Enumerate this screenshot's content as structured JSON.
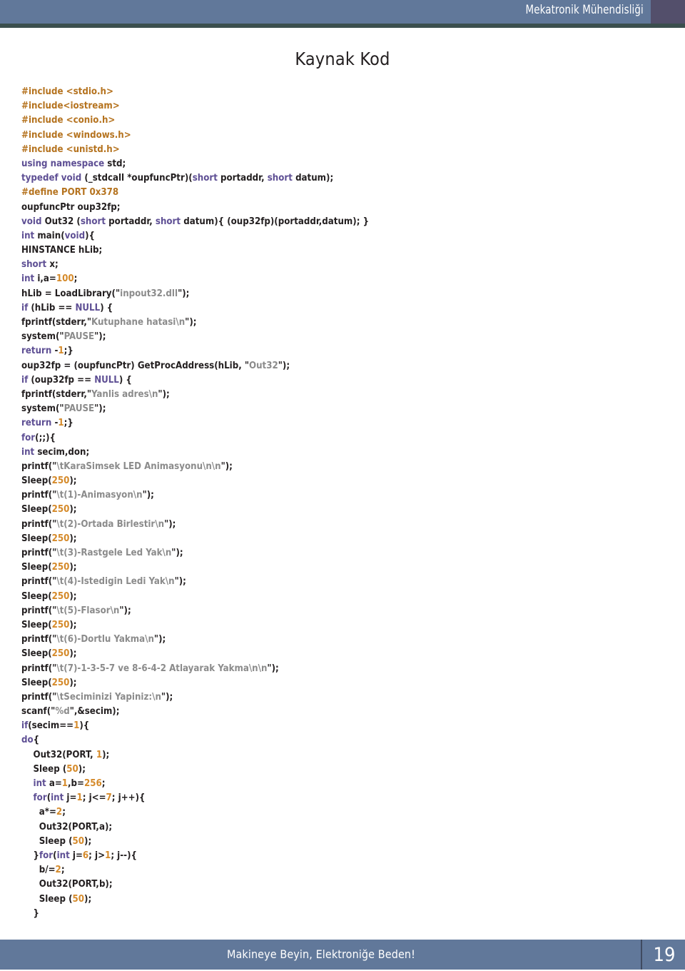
{
  "header": {
    "title": "Mekatronik Mühendisliği",
    "band_color": "#61789a",
    "right_block_color": "#534f6b",
    "rule_color": "#3b4f4e"
  },
  "page_title": "Kaynak Kod",
  "footer": {
    "tagline": "Makineye Beyin, Elektroniğe Beden!",
    "page_number": "19",
    "band_color": "#61789a"
  },
  "syntax_colors": {
    "keyword": "#5e4f94",
    "preprocessor": "#b5731f",
    "number": "#d58a2a",
    "string": "#8b8b8b",
    "default": "#231f20"
  },
  "code": {
    "language": "cpp",
    "lines": [
      [
        {
          "t": "#include <stdio.h>",
          "c": "pp"
        }
      ],
      [
        {
          "t": "#include<iostream>",
          "c": "pp"
        }
      ],
      [
        {
          "t": "#include <conio.h>",
          "c": "pp"
        }
      ],
      [
        {
          "t": "#include <windows.h>",
          "c": "pp"
        }
      ],
      [
        {
          "t": "#include <unistd.h>",
          "c": "pp"
        }
      ],
      [
        {
          "t": "using namespace ",
          "c": "k"
        },
        {
          "t": "std;",
          "c": "d"
        }
      ],
      [
        {
          "t": "typedef void ",
          "c": "k"
        },
        {
          "t": "(_stdcall *oupfuncPtr)(",
          "c": "d"
        },
        {
          "t": "short ",
          "c": "k"
        },
        {
          "t": "portaddr, ",
          "c": "d"
        },
        {
          "t": "short ",
          "c": "k"
        },
        {
          "t": "datum);",
          "c": "d"
        }
      ],
      [
        {
          "t": "#define PORT 0x378",
          "c": "pp"
        }
      ],
      [
        {
          "t": "oupfuncPtr oup32fp;",
          "c": "d"
        }
      ],
      [
        {
          "t": "void ",
          "c": "k"
        },
        {
          "t": "Out32 (",
          "c": "d"
        },
        {
          "t": "short ",
          "c": "k"
        },
        {
          "t": "portaddr, ",
          "c": "d"
        },
        {
          "t": "short ",
          "c": "k"
        },
        {
          "t": "datum){ (oup32fp)(portaddr,datum); }",
          "c": "d"
        }
      ],
      [
        {
          "t": "int ",
          "c": "k"
        },
        {
          "t": "main(",
          "c": "d"
        },
        {
          "t": "void",
          "c": "k"
        },
        {
          "t": "){",
          "c": "d"
        }
      ],
      [
        {
          "t": "HINSTANCE hLib;",
          "c": "d"
        }
      ],
      [
        {
          "t": "short ",
          "c": "k"
        },
        {
          "t": "x;",
          "c": "d"
        }
      ],
      [
        {
          "t": "int ",
          "c": "k"
        },
        {
          "t": "i,a=",
          "c": "d"
        },
        {
          "t": "100",
          "c": "n"
        },
        {
          "t": ";",
          "c": "d"
        }
      ],
      [
        {
          "t": "hLib = LoadLibrary(\"",
          "c": "d"
        },
        {
          "t": "inpout32.dll",
          "c": "s"
        },
        {
          "t": "\");",
          "c": "d"
        }
      ],
      [
        {
          "t": "if ",
          "c": "k"
        },
        {
          "t": "(hLib == ",
          "c": "d"
        },
        {
          "t": "NULL",
          "c": "k"
        },
        {
          "t": ") {",
          "c": "d"
        }
      ],
      [
        {
          "t": "fprintf(stderr,\"",
          "c": "d"
        },
        {
          "t": "Kutuphane hatasi\\n",
          "c": "s"
        },
        {
          "t": "\");",
          "c": "d"
        }
      ],
      [
        {
          "t": "system(\"",
          "c": "d"
        },
        {
          "t": "PAUSE",
          "c": "s"
        },
        {
          "t": "\");",
          "c": "d"
        }
      ],
      [
        {
          "t": "return ",
          "c": "k"
        },
        {
          "t": "-",
          "c": "d"
        },
        {
          "t": "1",
          "c": "n"
        },
        {
          "t": ";}",
          "c": "d"
        }
      ],
      [
        {
          "t": "oup32fp = (oupfuncPtr) GetProcAddress(hLib, \"",
          "c": "d"
        },
        {
          "t": "Out32",
          "c": "s"
        },
        {
          "t": "\");",
          "c": "d"
        }
      ],
      [
        {
          "t": "if ",
          "c": "k"
        },
        {
          "t": "(oup32fp == ",
          "c": "d"
        },
        {
          "t": "NULL",
          "c": "k"
        },
        {
          "t": ") {",
          "c": "d"
        }
      ],
      [
        {
          "t": "fprintf(stderr,\"",
          "c": "d"
        },
        {
          "t": "Yanlis adres\\n",
          "c": "s"
        },
        {
          "t": "\");",
          "c": "d"
        }
      ],
      [
        {
          "t": "system(\"",
          "c": "d"
        },
        {
          "t": "PAUSE",
          "c": "s"
        },
        {
          "t": "\");",
          "c": "d"
        }
      ],
      [
        {
          "t": "return ",
          "c": "k"
        },
        {
          "t": "-",
          "c": "d"
        },
        {
          "t": "1",
          "c": "n"
        },
        {
          "t": ";}",
          "c": "d"
        }
      ],
      [
        {
          "t": "for",
          "c": "k"
        },
        {
          "t": "(;;){",
          "c": "d"
        }
      ],
      [
        {
          "t": "int ",
          "c": "k"
        },
        {
          "t": "secim,don;",
          "c": "d"
        }
      ],
      [
        {
          "t": "printf(\"",
          "c": "d"
        },
        {
          "t": "\\tKaraSimsek LED Animasyonu\\n\\n",
          "c": "s"
        },
        {
          "t": "\");",
          "c": "d"
        }
      ],
      [
        {
          "t": "Sleep(",
          "c": "d"
        },
        {
          "t": "250",
          "c": "n"
        },
        {
          "t": ");",
          "c": "d"
        }
      ],
      [
        {
          "t": "printf(\"",
          "c": "d"
        },
        {
          "t": "\\t(1)-Animasyon\\n",
          "c": "s"
        },
        {
          "t": "\");",
          "c": "d"
        }
      ],
      [
        {
          "t": "Sleep(",
          "c": "d"
        },
        {
          "t": "250",
          "c": "n"
        },
        {
          "t": ");",
          "c": "d"
        }
      ],
      [
        {
          "t": "printf(\"",
          "c": "d"
        },
        {
          "t": "\\t(2)-Ortada Birlestir\\n",
          "c": "s"
        },
        {
          "t": "\");",
          "c": "d"
        }
      ],
      [
        {
          "t": "Sleep(",
          "c": "d"
        },
        {
          "t": "250",
          "c": "n"
        },
        {
          "t": ");",
          "c": "d"
        }
      ],
      [
        {
          "t": "printf(\"",
          "c": "d"
        },
        {
          "t": "\\t(3)-Rastgele Led Yak\\n",
          "c": "s"
        },
        {
          "t": "\");",
          "c": "d"
        }
      ],
      [
        {
          "t": "Sleep(",
          "c": "d"
        },
        {
          "t": "250",
          "c": "n"
        },
        {
          "t": ");",
          "c": "d"
        }
      ],
      [
        {
          "t": "printf(\"",
          "c": "d"
        },
        {
          "t": "\\t(4)-Istedigin Ledi Yak\\n",
          "c": "s"
        },
        {
          "t": "\");",
          "c": "d"
        }
      ],
      [
        {
          "t": "Sleep(",
          "c": "d"
        },
        {
          "t": "250",
          "c": "n"
        },
        {
          "t": ");",
          "c": "d"
        }
      ],
      [
        {
          "t": "printf(\"",
          "c": "d"
        },
        {
          "t": "\\t(5)-Flasor\\n",
          "c": "s"
        },
        {
          "t": "\");",
          "c": "d"
        }
      ],
      [
        {
          "t": "Sleep(",
          "c": "d"
        },
        {
          "t": "250",
          "c": "n"
        },
        {
          "t": ");",
          "c": "d"
        }
      ],
      [
        {
          "t": "printf(\"",
          "c": "d"
        },
        {
          "t": "\\t(6)-Dortlu Yakma\\n",
          "c": "s"
        },
        {
          "t": "\");",
          "c": "d"
        }
      ],
      [
        {
          "t": "Sleep(",
          "c": "d"
        },
        {
          "t": "250",
          "c": "n"
        },
        {
          "t": ");",
          "c": "d"
        }
      ],
      [
        {
          "t": "printf(\"",
          "c": "d"
        },
        {
          "t": "\\t(7)-1-3-5-7 ve 8-6-4-2 Atlayarak Yakma\\n\\n",
          "c": "s"
        },
        {
          "t": "\");",
          "c": "d"
        }
      ],
      [
        {
          "t": "Sleep(",
          "c": "d"
        },
        {
          "t": "250",
          "c": "n"
        },
        {
          "t": ");",
          "c": "d"
        }
      ],
      [
        {
          "t": "printf(\"",
          "c": "d"
        },
        {
          "t": "\\tSeciminizi Yapiniz:\\n",
          "c": "s"
        },
        {
          "t": "\");",
          "c": "d"
        }
      ],
      [
        {
          "t": "scanf(\"",
          "c": "d"
        },
        {
          "t": "%d",
          "c": "s"
        },
        {
          "t": "\",&secim);",
          "c": "d"
        }
      ],
      [
        {
          "t": "if",
          "c": "k"
        },
        {
          "t": "(secim==",
          "c": "d"
        },
        {
          "t": "1",
          "c": "n"
        },
        {
          "t": "){",
          "c": "d"
        }
      ],
      [
        {
          "t": "do",
          "c": "k"
        },
        {
          "t": "{",
          "c": "d"
        }
      ],
      [
        {
          "t": "    Out32(PORT, ",
          "c": "d"
        },
        {
          "t": "1",
          "c": "n"
        },
        {
          "t": ");",
          "c": "d"
        }
      ],
      [
        {
          "t": "    Sleep (",
          "c": "d"
        },
        {
          "t": "50",
          "c": "n"
        },
        {
          "t": ");",
          "c": "d"
        }
      ],
      [
        {
          "t": "    ",
          "c": "d"
        },
        {
          "t": "int ",
          "c": "k"
        },
        {
          "t": "a=",
          "c": "d"
        },
        {
          "t": "1",
          "c": "n"
        },
        {
          "t": ",b=",
          "c": "d"
        },
        {
          "t": "256",
          "c": "n"
        },
        {
          "t": ";",
          "c": "d"
        }
      ],
      [
        {
          "t": "    ",
          "c": "d"
        },
        {
          "t": "for",
          "c": "k"
        },
        {
          "t": "(",
          "c": "d"
        },
        {
          "t": "int ",
          "c": "k"
        },
        {
          "t": "j=",
          "c": "d"
        },
        {
          "t": "1",
          "c": "n"
        },
        {
          "t": "; j<=",
          "c": "d"
        },
        {
          "t": "7",
          "c": "n"
        },
        {
          "t": "; j++){",
          "c": "d"
        }
      ],
      [
        {
          "t": "      a*=",
          "c": "d"
        },
        {
          "t": "2",
          "c": "n"
        },
        {
          "t": ";",
          "c": "d"
        }
      ],
      [
        {
          "t": "      Out32(PORT,a);",
          "c": "d"
        }
      ],
      [
        {
          "t": "      Sleep (",
          "c": "d"
        },
        {
          "t": "50",
          "c": "n"
        },
        {
          "t": ");",
          "c": "d"
        }
      ],
      [
        {
          "t": "    }",
          "c": "d"
        },
        {
          "t": "for",
          "c": "k"
        },
        {
          "t": "(",
          "c": "d"
        },
        {
          "t": "int ",
          "c": "k"
        },
        {
          "t": "j=",
          "c": "d"
        },
        {
          "t": "6",
          "c": "n"
        },
        {
          "t": "; j>",
          "c": "d"
        },
        {
          "t": "1",
          "c": "n"
        },
        {
          "t": "; j--){",
          "c": "d"
        }
      ],
      [
        {
          "t": "      b/=",
          "c": "d"
        },
        {
          "t": "2",
          "c": "n"
        },
        {
          "t": ";",
          "c": "d"
        }
      ],
      [
        {
          "t": "      Out32(PORT,b);",
          "c": "d"
        }
      ],
      [
        {
          "t": "      Sleep (",
          "c": "d"
        },
        {
          "t": "50",
          "c": "n"
        },
        {
          "t": ");",
          "c": "d"
        }
      ],
      [
        {
          "t": "    }",
          "c": "d"
        }
      ]
    ]
  }
}
